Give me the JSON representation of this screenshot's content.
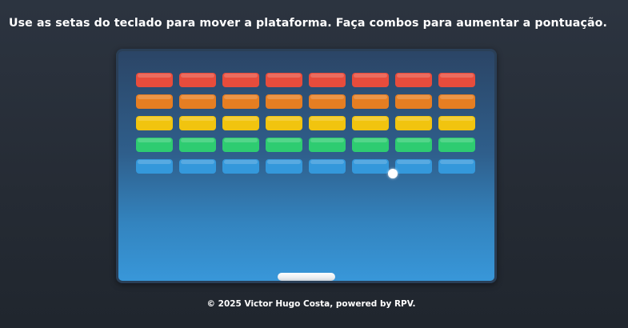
{
  "instructions": "Use as setas do teclado para mover a plataforma. Faça combos para aumentar a pontuação.",
  "footer": "© 2025 Victor Hugo Costa, powered by RPV.",
  "colors": {
    "background": "#252b34",
    "board_top": "#2b4566",
    "board_bottom": "#3897d9",
    "paddle": "#ffffff",
    "ball": "#ffffff"
  },
  "bricks": {
    "columns": 8,
    "rows": [
      {
        "color": "#e74c3c",
        "name": "red"
      },
      {
        "color": "#e67e22",
        "name": "orange"
      },
      {
        "color": "#f1c40f",
        "name": "yellow"
      },
      {
        "color": "#2ecc71",
        "name": "green"
      },
      {
        "color": "#3498db",
        "name": "blue"
      }
    ],
    "destroyed": []
  }
}
